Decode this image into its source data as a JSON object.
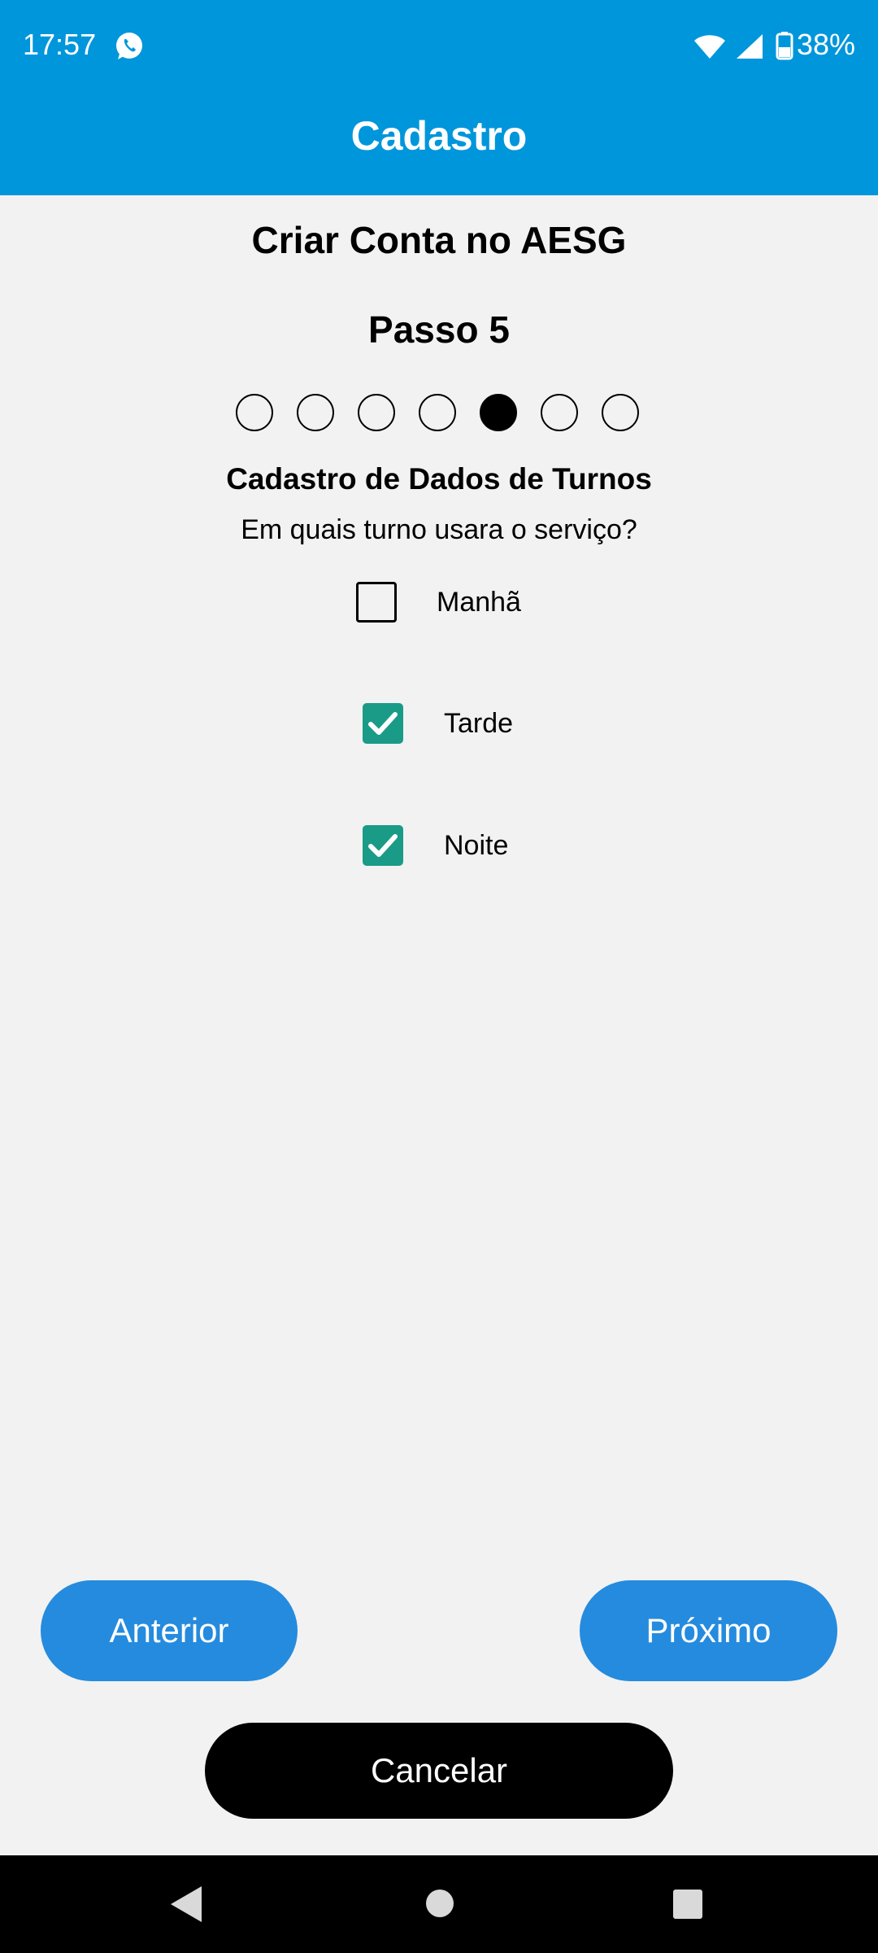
{
  "status_bar": {
    "time": "17:57",
    "battery": "38%",
    "icons": [
      "whatsapp-icon",
      "wifi-icon",
      "signal-icon",
      "battery-icon"
    ]
  },
  "app_bar": {
    "title": "Cadastro"
  },
  "form": {
    "title": "Criar Conta no AESG",
    "step_label": "Passo 5",
    "steps_total": 7,
    "current_step": 5,
    "section_title": "Cadastro de Dados de Turnos",
    "question": "Em quais turno usara o serviço?",
    "options": [
      {
        "label": "Manhã",
        "checked": false
      },
      {
        "label": "Tarde",
        "checked": true
      },
      {
        "label": "Noite",
        "checked": true
      }
    ]
  },
  "buttons": {
    "previous": "Anterior",
    "next": "Próximo",
    "cancel": "Cancelar"
  },
  "colors": {
    "app_bar": "#0096db",
    "button_primary": "#258bde",
    "checkbox_checked": "#1a9b88",
    "background": "#f2f2f2"
  },
  "nav_bar": {
    "icons": [
      "back-icon",
      "home-icon",
      "recents-icon"
    ]
  }
}
